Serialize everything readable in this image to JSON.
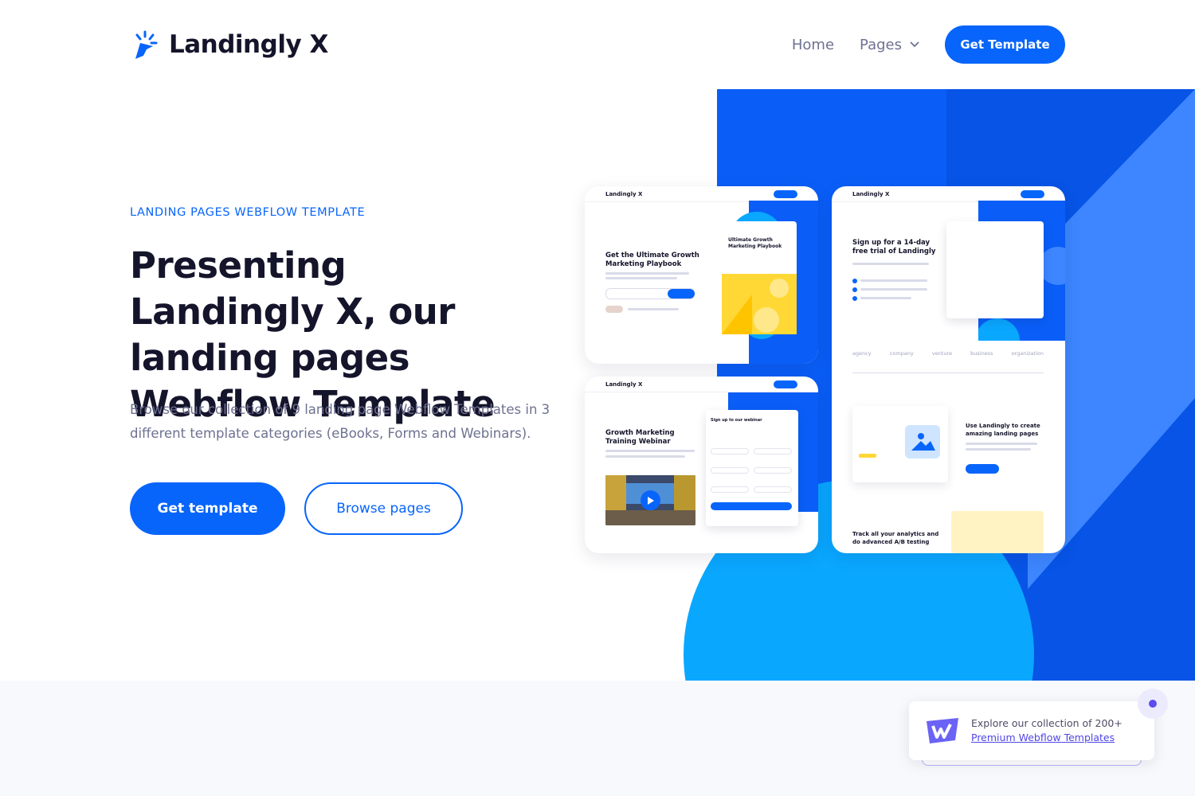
{
  "brand": {
    "name": "Landingly X",
    "accent": "#0865fb",
    "dark": "#14142b",
    "muted": "#6e7191"
  },
  "nav": {
    "home": "Home",
    "pages": "Pages",
    "cta": "Get Template"
  },
  "hero": {
    "eyebrow": "LANDING PAGES WEBFLOW TEMPLATE",
    "headline": "Presenting Landingly X, our landing pages Webflow Template",
    "subtext": "Browse our collection of 9 landing page Webflow Templates in 3 different template categories (eBooks, Forms and Webinars).",
    "primary_button": "Get template",
    "secondary_button": "Browse pages"
  },
  "previews": {
    "ebook": {
      "logo": "Landingly X",
      "title": "Get the Ultimate Growth Marketing Playbook",
      "book_title": "Ultimate Growth Marketing Playbook"
    },
    "webinar": {
      "logo": "Landingly X",
      "title": "Growth Marketing Training Webinar",
      "form_title": "Sign up to our webinar"
    },
    "trial": {
      "logo": "Landingly X",
      "title": "Sign up for a 14-day free trial of Landingly",
      "logos": [
        "agency",
        "company",
        "venture",
        "business",
        "organization"
      ],
      "feature_title": "Use Landingly to create amazing landing pages",
      "analytics_title": "Track all your analytics and do advanced A/B testing"
    }
  },
  "promo": {
    "text": "Explore our collection of 200+",
    "link": "Premium Webflow Templates"
  }
}
